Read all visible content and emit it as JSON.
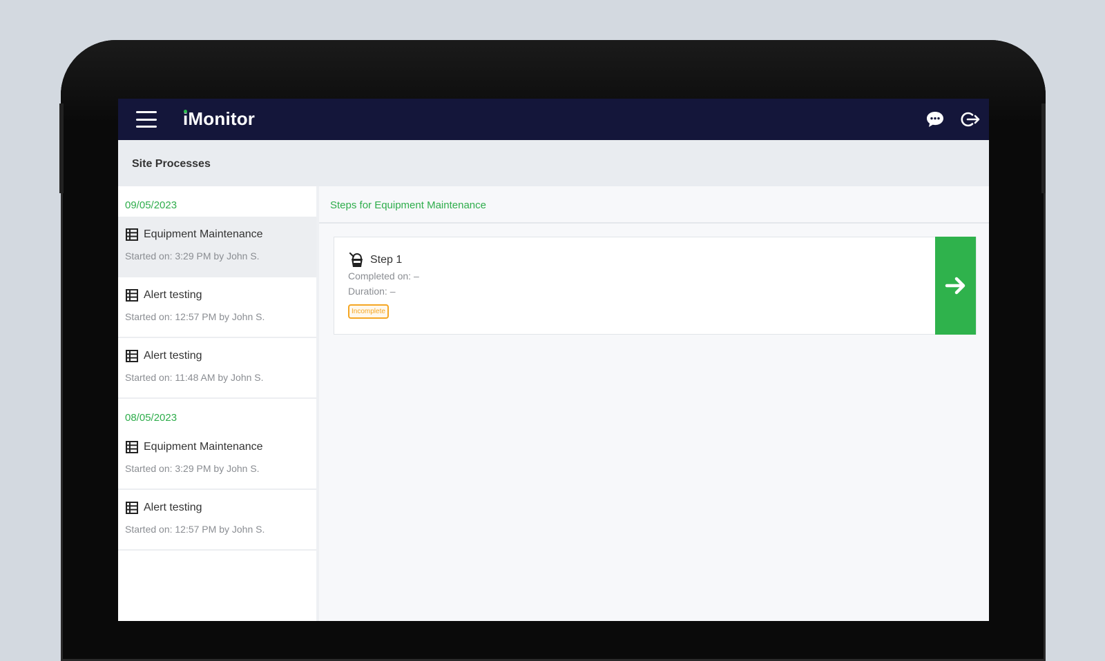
{
  "app": {
    "name": "iMonitor",
    "brand_color": "#14163a",
    "accent_color": "#2ead4b"
  },
  "topbar": {
    "menu_icon": "hamburger-menu-icon",
    "chat_icon": "chat-bubble-icon",
    "logout_icon": "logout-icon"
  },
  "page": {
    "title": "Site Processes"
  },
  "processes": {
    "groups": [
      {
        "date": "09/05/2023",
        "items": [
          {
            "name": "Equipment Maintenance",
            "meta": "Started on: 3:29 PM by John S.",
            "selected": true
          },
          {
            "name": "Alert testing",
            "meta": "Started on: 12:57 PM by John S."
          },
          {
            "name": "Alert testing",
            "meta": "Started on: 11:48 AM by John S."
          }
        ]
      },
      {
        "date": "08/05/2023",
        "items": [
          {
            "name": "Equipment Maintenance",
            "meta": "Started on: 3:29 PM by John S."
          },
          {
            "name": "Alert testing",
            "meta": "Started on: 12:57 PM by John S."
          }
        ]
      }
    ]
  },
  "steps": {
    "header": "Steps for Equipment Maintenance",
    "items": [
      {
        "title": "Step 1",
        "completed": "Completed on: –",
        "duration": "Duration: –",
        "status": "Incomplete",
        "status_color": "#f5a623",
        "action_icon": "arrow-right-icon"
      }
    ]
  }
}
